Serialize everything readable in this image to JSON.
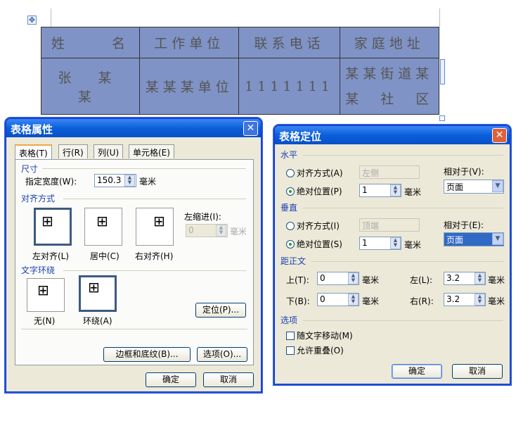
{
  "doc_table": {
    "rows": [
      [
        "姓　　名",
        "工作单位",
        "联系电话",
        "家庭地址"
      ],
      [
        "张 某 某",
        "某某某单位",
        "1111111",
        "某某街道某\n某　社　区"
      ]
    ],
    "addr_line1": "某某街道某",
    "addr_line2": "某　社　区"
  },
  "table_properties": {
    "title": "表格属性",
    "tabs": [
      "表格(T)",
      "行(R)",
      "列(U)",
      "单元格(E)"
    ],
    "size_group": "尺寸",
    "width_label": "指定宽度(W):",
    "width_value": "150.3",
    "unit": "毫米",
    "align_group": "对齐方式",
    "align_options": [
      "左对齐(L)",
      "居中(C)",
      "右对齐(H)"
    ],
    "indent_label": "左缩进(I):",
    "indent_value": "0",
    "wrap_group": "文字环绕",
    "wrap_options": [
      "无(N)",
      "环绕(A)"
    ],
    "position_button": "定位(P)...",
    "borders_button": "边框和底纹(B)...",
    "options_button": "选项(O)...",
    "ok": "确定",
    "cancel": "取消"
  },
  "table_positioning": {
    "title": "表格定位",
    "horizontal": {
      "group": "水平",
      "align_label": "对齐方式(A)",
      "align_value": "左侧",
      "abs_label": "绝对位置(P)",
      "abs_value": "1",
      "unit": "毫米",
      "relative_label": "相对于(V):",
      "relative_value": "页面"
    },
    "vertical": {
      "group": "垂直",
      "align_label": "对齐方式(I)",
      "align_value": "顶端",
      "abs_label": "绝对位置(S)",
      "abs_value": "1",
      "unit": "毫米",
      "relative_label": "相对于(E):",
      "relative_value": "页面"
    },
    "distance": {
      "group": "距正文",
      "top_label": "上(T):",
      "top_value": "0",
      "bottom_label": "下(B):",
      "bottom_value": "0",
      "left_label": "左(L):",
      "left_value": "3.2",
      "right_label": "右(R):",
      "right_value": "3.2",
      "unit": "毫米"
    },
    "options": {
      "group": "选项",
      "move_with_text": "随文字移动(M)",
      "allow_overlap": "允许重叠(O)"
    },
    "ok": "确定",
    "cancel": "取消"
  }
}
